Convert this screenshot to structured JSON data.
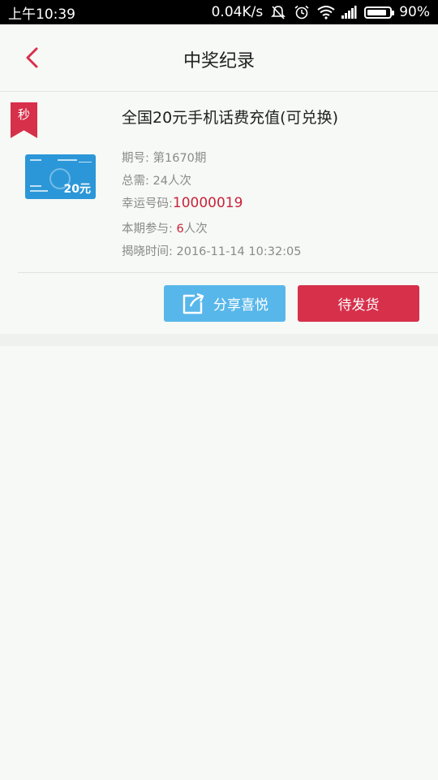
{
  "status_bar": {
    "time": "上午10:39",
    "net_speed": "0.04K/s",
    "battery": "90%",
    "battery_level": 0.9,
    "icons": [
      "mute-icon",
      "alarm-icon",
      "wifi-icon",
      "signal-icon",
      "battery-icon"
    ]
  },
  "header": {
    "title": "中奖纪录",
    "back_icon": "chevron-left-icon"
  },
  "record": {
    "tag": "秒",
    "title": "全国20元手机话费充值(可兑换)",
    "thumb_amount": "20元",
    "period_label": "期号:",
    "period_value": "第1670期",
    "total_label": "总需:",
    "total_value": "24人次",
    "lucky_label": "幸运号码:",
    "lucky_value": "10000019",
    "joined_label": "本期参与:",
    "joined_count": "6",
    "joined_unit": "人次",
    "reveal_label": "揭晓时间:",
    "reveal_value": "2016-11-14 10:32:05"
  },
  "actions": {
    "share_label": "分享喜悦",
    "ship_label": "待发货"
  },
  "colors": {
    "accent_red": "#d7304b",
    "share_blue": "#58b7ea",
    "background": "#f6f9f5"
  }
}
